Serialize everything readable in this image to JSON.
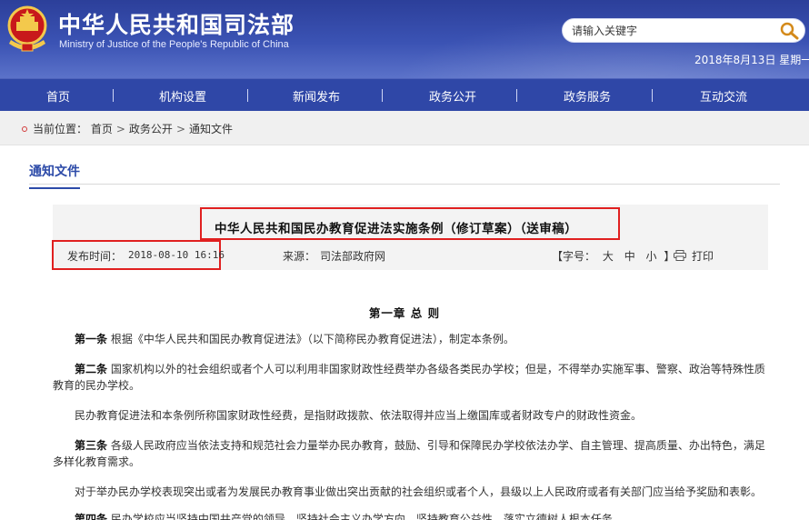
{
  "header": {
    "title": "中华人民共和国司法部",
    "subtitle": "Ministry of Justice of the People's Republic of China",
    "search_placeholder": "请输入关键字",
    "date": "2018年8月13日 星期一"
  },
  "nav": [
    "首页",
    "机构设置",
    "新闻发布",
    "政务公开",
    "政务服务",
    "互动交流"
  ],
  "breadcrumb": {
    "label": "当前位置：",
    "items": [
      "首页",
      "政务公开",
      "通知文件"
    ]
  },
  "section_title": "通知文件",
  "article": {
    "title": "中华人民共和国民办教育促进法实施条例（修订草案）（送审稿）",
    "pub_label": "发布时间：",
    "pub_time": "2018-08-10 16:16",
    "source_label": "来源：",
    "source": "司法部政府网",
    "font_label": "【字号：",
    "font_large": "大",
    "font_medium": "中",
    "font_small": "小",
    "font_close": "】",
    "print": "打印",
    "chapter": "第一章 总 则",
    "paragraphs": [
      {
        "lead": "第一条",
        "text": "根据《中华人民共和国民办教育促进法》（以下简称民办教育促进法），制定本条例。"
      },
      {
        "lead": "第二条",
        "text": "国家机构以外的社会组织或者个人可以利用非国家财政性经费举办各级各类民办学校；但是，不得举办实施军事、警察、政治等特殊性质教育的民办学校。"
      },
      {
        "lead": "",
        "text": "民办教育促进法和本条例所称国家财政性经费，是指财政拨款、依法取得并应当上缴国库或者财政专户的财政性资金。"
      },
      {
        "lead": "第三条",
        "text": "各级人民政府应当依法支持和规范社会力量举办民办教育，鼓励、引导和保障民办学校依法办学、自主管理、提高质量、办出特色，满足多样化教育需求。"
      },
      {
        "lead": "",
        "text": "对于举办民办学校表现突出或者为发展民办教育事业做出突出贡献的社会组织或者个人，县级以上人民政府或者有关部门应当给予奖励和表彰。"
      },
      {
        "lead": "第四条",
        "text": "民办学校应当坚持中国共产党的领导，坚持社会主义办学方向，坚持教育公益性，落实立德树人根本任务。"
      }
    ]
  }
}
